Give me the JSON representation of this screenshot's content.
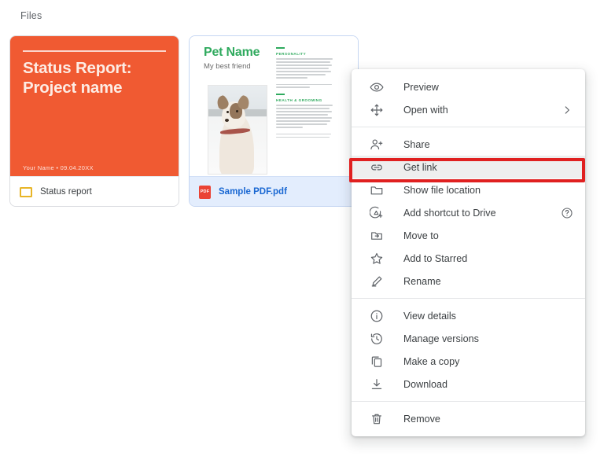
{
  "section": {
    "label": "Files"
  },
  "cards": [
    {
      "id": "status-report",
      "thumb_title": "Status Report:\nProject name",
      "thumb_byline": "Your Name • 09.04.20XX",
      "file_name": "Status report",
      "icon": "slides-icon",
      "selected": false
    },
    {
      "id": "sample-pdf",
      "pet_title": "Pet Name",
      "pet_subtitle": "My best friend",
      "section_1": "PERSONALITY",
      "section_2": "HEALTH & GROOMING",
      "file_name": "Sample PDF.pdf",
      "icon": "pdf-icon",
      "icon_label": "PDF",
      "selected": true
    }
  ],
  "context_menu": {
    "groups": [
      {
        "items": [
          {
            "label": "Preview",
            "icon": "eye-icon",
            "trailing": ""
          },
          {
            "label": "Open with",
            "icon": "open-with-icon",
            "trailing": "chevron-right-icon"
          }
        ]
      },
      {
        "items": [
          {
            "label": "Share",
            "icon": "person-add-icon",
            "trailing": ""
          },
          {
            "label": "Get link",
            "icon": "link-icon",
            "trailing": "",
            "highlighted": true
          },
          {
            "label": "Show file location",
            "icon": "folder-icon",
            "trailing": ""
          },
          {
            "label": "Add shortcut to Drive",
            "icon": "add-shortcut-icon",
            "trailing": "help-icon"
          },
          {
            "label": "Move to",
            "icon": "move-to-folder-icon",
            "trailing": ""
          },
          {
            "label": "Add to Starred",
            "icon": "star-icon",
            "trailing": ""
          },
          {
            "label": "Rename",
            "icon": "pencil-icon",
            "trailing": ""
          }
        ]
      },
      {
        "items": [
          {
            "label": "View details",
            "icon": "info-icon",
            "trailing": ""
          },
          {
            "label": "Manage versions",
            "icon": "history-icon",
            "trailing": ""
          },
          {
            "label": "Make a copy",
            "icon": "copy-icon",
            "trailing": ""
          },
          {
            "label": "Download",
            "icon": "download-icon",
            "trailing": ""
          }
        ]
      },
      {
        "items": [
          {
            "label": "Remove",
            "icon": "trash-icon",
            "trailing": ""
          }
        ]
      }
    ]
  },
  "annotation": {
    "color": "#e02020",
    "target": "Get link"
  },
  "colors": {
    "slide_orange": "#f05a32",
    "pdf_red": "#ea4335",
    "slides_yellow": "#e8b527",
    "selected_blue_bg": "#e3edfd",
    "selected_blue_text": "#1967d2",
    "menu_text": "#3c4043",
    "pet_green": "#2faa5e"
  }
}
